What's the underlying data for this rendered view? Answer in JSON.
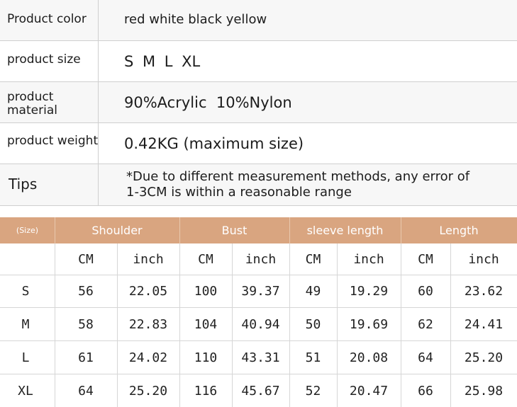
{
  "info": {
    "color_label": "Product color",
    "color_value": "red white black yellow",
    "size_label": "product size",
    "size_value": "S M L XL",
    "material_label_1": "product",
    "material_label_2": "material",
    "material_value": "90%Acrylic  10%Nylon",
    "weight_label": "product weight",
    "weight_value": "0.42KG (maximum size)",
    "tips_label": "Tips",
    "tips_line1": "*Due to different measurement methods, any error of",
    "tips_line2": "1-3CM is within a reasonable range"
  },
  "size_chart": {
    "size_header": "(Size)",
    "groups": [
      "Shoulder",
      "Bust",
      "sleeve length",
      "Length"
    ],
    "units": [
      "CM",
      "inch",
      "CM",
      "inch",
      "CM",
      "inch",
      "CM",
      "inch"
    ],
    "rows": [
      {
        "size": "S",
        "values": [
          "56",
          "22.05",
          "100",
          "39.37",
          "49",
          "19.29",
          "60",
          "23.62"
        ]
      },
      {
        "size": "M",
        "values": [
          "58",
          "22.83",
          "104",
          "40.94",
          "50",
          "19.69",
          "62",
          "24.41"
        ]
      },
      {
        "size": "L",
        "values": [
          "61",
          "24.02",
          "110",
          "43.31",
          "51",
          "20.08",
          "64",
          "25.20"
        ]
      },
      {
        "size": "XL",
        "values": [
          "64",
          "25.20",
          "116",
          "45.67",
          "52",
          "20.47",
          "66",
          "25.98"
        ]
      }
    ]
  },
  "colors": {
    "header_bg": "#d9a580",
    "header_text": "#ffffff",
    "row_alt_bg": "#f7f7f7",
    "border": "#cfcfcf"
  }
}
